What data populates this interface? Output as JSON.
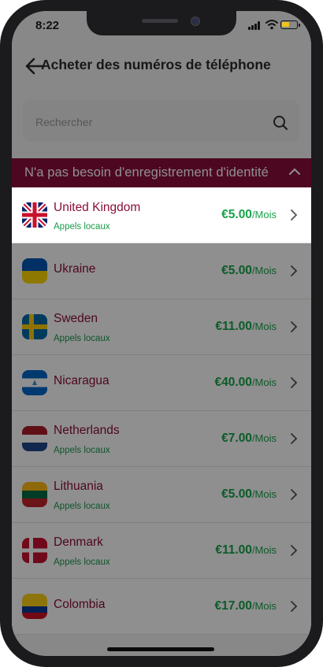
{
  "status": {
    "time": "8:22"
  },
  "header": {
    "title": "Acheter des numéros de téléphone"
  },
  "search": {
    "placeholder": "Rechercher"
  },
  "section": {
    "title": "N'a pas besoin d'enregistrement d'identité"
  },
  "rows": [
    {
      "name": "United Kingdom",
      "sub": "Appels locaux",
      "price": "€5.00",
      "unit": "/Mois"
    },
    {
      "name": "Ukraine",
      "sub": "",
      "price": "€5.00",
      "unit": "/Mois"
    },
    {
      "name": "Sweden",
      "sub": "Appels locaux",
      "price": "€11.00",
      "unit": "/Mois"
    },
    {
      "name": "Nicaragua",
      "sub": "",
      "price": "€40.00",
      "unit": "/Mois"
    },
    {
      "name": "Netherlands",
      "sub": "Appels locaux",
      "price": "€7.00",
      "unit": "/Mois"
    },
    {
      "name": "Lithuania",
      "sub": "Appels locaux",
      "price": "€5.00",
      "unit": "/Mois"
    },
    {
      "name": "Denmark",
      "sub": "Appels locaux",
      "price": "€11.00",
      "unit": "/Mois"
    },
    {
      "name": "Colombia",
      "sub": "",
      "price": "€17.00",
      "unit": "/Mois"
    }
  ],
  "colors": {
    "accent": "#8b0d3b",
    "price": "#16a34a",
    "sub": "#1a9a4a"
  },
  "icons": {
    "back": "arrow-left-icon",
    "search": "search-icon",
    "row": "chevron-right-icon",
    "section": "chevron-up-icon"
  }
}
